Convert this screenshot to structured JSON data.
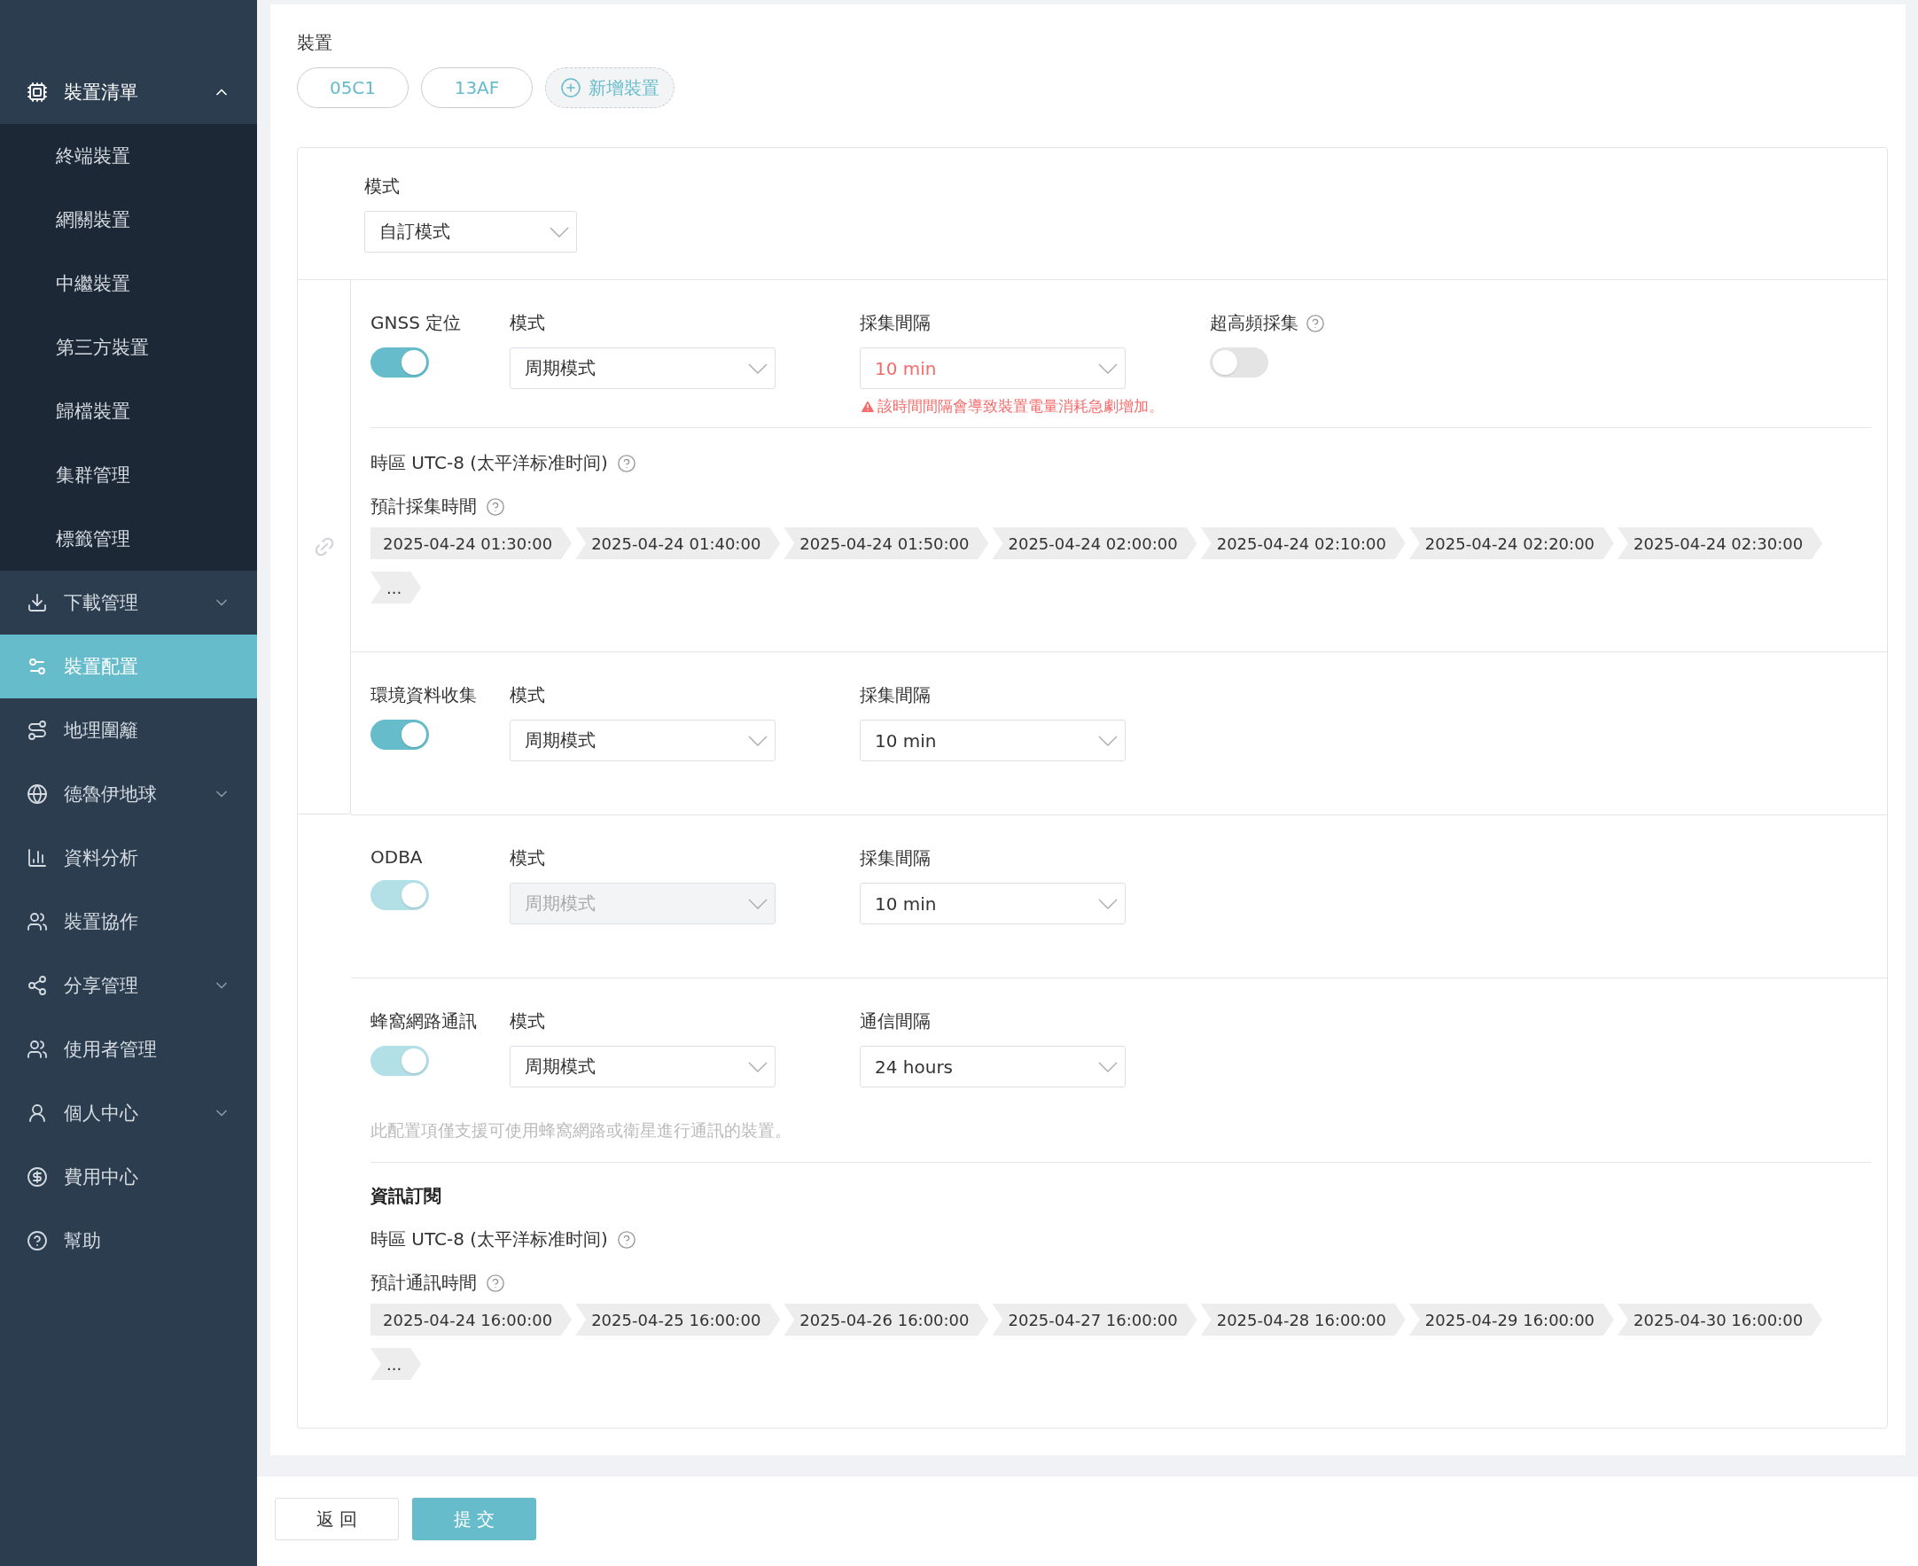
{
  "sidebar": {
    "items": [
      {
        "label": "裝置清單",
        "selected": false,
        "expanded": true,
        "children": [
          {
            "label": "終端裝置",
            "selected": false
          },
          {
            "label": "網關裝置",
            "selected": false
          },
          {
            "label": "中繼裝置",
            "selected": false
          },
          {
            "label": "第三方裝置",
            "selected": false
          },
          {
            "label": "歸檔裝置",
            "selected": false
          },
          {
            "label": "集群管理",
            "selected": false
          },
          {
            "label": "標籤管理",
            "selected": false
          }
        ]
      },
      {
        "label": "下載管理",
        "selected": false,
        "expanded": false
      },
      {
        "label": "裝置配置",
        "selected": true
      },
      {
        "label": "地理圍籬",
        "selected": false
      },
      {
        "label": "德魯伊地球",
        "selected": false,
        "expanded": false
      },
      {
        "label": "資料分析",
        "selected": false
      },
      {
        "label": "裝置協作",
        "selected": false
      },
      {
        "label": "分享管理",
        "selected": false,
        "expanded": false
      },
      {
        "label": "使用者管理",
        "selected": false
      },
      {
        "label": "個人中心",
        "selected": false,
        "expanded": false
      },
      {
        "label": "費用中心",
        "selected": false
      },
      {
        "label": "幫助",
        "selected": false
      }
    ]
  },
  "device": {
    "label": "裝置",
    "chips": [
      "05C1",
      "13AF"
    ],
    "add_button": "新增裝置"
  },
  "mode": {
    "label": "模式",
    "value": "自訂模式"
  },
  "section_groups": [
    {
      "linked": true,
      "sections": [
        {
          "title": "GNSS 定位",
          "on": true,
          "disabled": false,
          "fields": [
            {
              "kind": "select",
              "label": "模式",
              "value": "周期模式",
              "disabled": false
            },
            {
              "kind": "select",
              "label": "採集間隔",
              "value": "10 min",
              "disabled": false,
              "warning": "該時間間隔會導致裝置電量消耗急劇增加。"
            },
            {
              "kind": "switch",
              "label": "超高頻採集",
              "on": false,
              "help": true
            }
          ],
          "timezone": "時區 UTC-8 (太平洋标准时间)",
          "schedule": {
            "label": "預計採集時間",
            "times": [
              "2025-04-24 01:30:00",
              "2025-04-24 01:40:00",
              "2025-04-24 01:50:00",
              "2025-04-24 02:00:00",
              "2025-04-24 02:10:00",
              "2025-04-24 02:20:00",
              "2025-04-24 02:30:00"
            ],
            "more": "..."
          }
        },
        {
          "title": "環境資料收集",
          "on": true,
          "disabled": false,
          "fields": [
            {
              "kind": "select",
              "label": "模式",
              "value": "周期模式",
              "disabled": false
            },
            {
              "kind": "select",
              "label": "採集間隔",
              "value": "10 min",
              "disabled": false
            }
          ]
        }
      ]
    },
    {
      "linked": false,
      "sections": [
        {
          "title": "ODBA",
          "on": true,
          "disabled": true,
          "fields": [
            {
              "kind": "select",
              "label": "模式",
              "value": "周期模式",
              "disabled": true
            },
            {
              "kind": "select",
              "label": "採集間隔",
              "value": "10 min",
              "disabled": false
            }
          ]
        },
        {
          "title": "蜂窩網路通訊",
          "on": true,
          "disabled": true,
          "fields": [
            {
              "kind": "select",
              "label": "模式",
              "value": "周期模式",
              "disabled": false
            },
            {
              "kind": "select",
              "label": "通信間隔",
              "value": "24 hours",
              "disabled": false
            }
          ],
          "note": "此配置項僅支援可使用蜂窩網路或衛星進行通訊的裝置。",
          "subscription": {
            "title": "資訊訂閱",
            "timezone": "時區 UTC-8 (太平洋标准时间)",
            "schedule": {
              "label": "預計通訊時間",
              "times": [
                "2025-04-24 16:00:00",
                "2025-04-25 16:00:00",
                "2025-04-26 16:00:00",
                "2025-04-27 16:00:00",
                "2025-04-28 16:00:00",
                "2025-04-29 16:00:00",
                "2025-04-30 16:00:00"
              ],
              "more": "..."
            }
          }
        }
      ]
    }
  ],
  "footer": {
    "back": "返 回",
    "submit": "提 交"
  }
}
